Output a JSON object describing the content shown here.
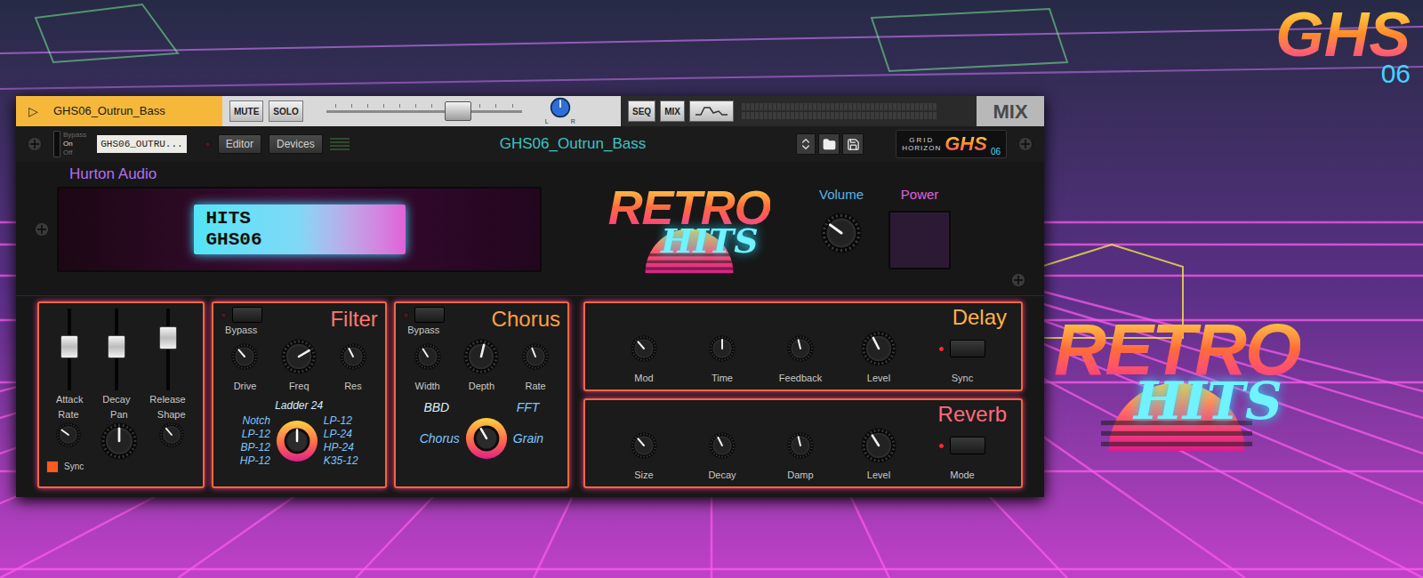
{
  "background": {
    "ghs_logo": {
      "text": "GHS",
      "number": "06"
    },
    "retro_logo": {
      "retro": "RETRO",
      "hits": "HITS"
    }
  },
  "track_strip": {
    "play": "▷",
    "name": "GHS06_Outrun_Bass",
    "buttons": [
      {
        "label": "MUTE",
        "on": false
      },
      {
        "label": "SOLO",
        "on": false
      }
    ],
    "fader": {
      "level": 0.7
    },
    "pan": {
      "level": 0.5,
      "left": "L",
      "right": "R"
    },
    "views": [
      {
        "label": "SEQ",
        "selected": false
      },
      {
        "label": "MIX",
        "selected": false
      }
    ],
    "meter": {
      "level": 0
    },
    "mix_tab": "MIX"
  },
  "device_header": {
    "switch": [
      {
        "label": "Bypass",
        "selected": false
      },
      {
        "label": "On",
        "selected": true
      },
      {
        "label": "Off",
        "selected": false
      }
    ],
    "tape_label": "GHS06_OUTRU...",
    "buttons": [
      "Editor",
      "Devices"
    ],
    "patch_name": "GHS06_Outrun_Bass",
    "brand": {
      "line1": "GRID",
      "line2": "HORIZON",
      "ghs": "GHS",
      "number": "06"
    }
  },
  "maker": "Hurton Audio",
  "display": {
    "line1": "HITS",
    "line2": "GHS06"
  },
  "logo": {
    "retro": "RETRO",
    "hits": "HITS"
  },
  "volume": {
    "label": "Volume",
    "level": 0.3
  },
  "power": {
    "label": "Power",
    "on": false
  },
  "envelope": {
    "sliders": [
      {
        "label": "Attack",
        "level": 0.55
      },
      {
        "label": "Decay",
        "level": 0.55
      },
      {
        "label": "Release",
        "level": 0.7
      }
    ],
    "knobs": [
      {
        "label": "Rate",
        "level": 0.3,
        "kind": "small"
      },
      {
        "label": "Pan",
        "level": 0.5,
        "kind": "large"
      },
      {
        "label": "Shape",
        "level": 0.35,
        "kind": "small"
      }
    ],
    "sync": {
      "label": "Sync",
      "on": true
    }
  },
  "filter": {
    "title": "Filter",
    "bypass": {
      "label": "Bypass",
      "on": false
    },
    "knobs": [
      {
        "label": "Drive",
        "level": 0.35,
        "kind": "small"
      },
      {
        "label": "Freq",
        "level": 0.72,
        "kind": "large"
      },
      {
        "label": "Res",
        "level": 0.4,
        "kind": "small"
      }
    ],
    "selector": {
      "top": [
        {
          "label": "Ladder 24",
          "selected": true
        }
      ],
      "left": [
        {
          "label": "Notch",
          "selected": false
        },
        {
          "label": "LP-12",
          "selected": false
        },
        {
          "label": "BP-12",
          "selected": false
        },
        {
          "label": "HP-12",
          "selected": false
        }
      ],
      "right": [
        {
          "label": "LP-12",
          "selected": false
        },
        {
          "label": "LP-24",
          "selected": false
        },
        {
          "label": "HP-24",
          "selected": false
        },
        {
          "label": "K35-12",
          "selected": false
        }
      ]
    }
  },
  "chorus": {
    "title": "Chorus",
    "bypass": {
      "label": "Bypass",
      "on": false
    },
    "knobs": [
      {
        "label": "Width",
        "level": 0.38,
        "kind": "small"
      },
      {
        "label": "Depth",
        "level": 0.55,
        "kind": "large"
      },
      {
        "label": "Rate",
        "level": 0.42,
        "kind": "small"
      }
    ],
    "selector": {
      "top": [
        {
          "label": "BBD",
          "selected": true
        },
        {
          "label": "FFT",
          "selected": false
        }
      ],
      "left": [
        {
          "label": "Chorus",
          "selected": false
        }
      ],
      "right": [
        {
          "label": "Grain",
          "selected": false
        }
      ]
    }
  },
  "delay": {
    "title": "Delay",
    "knobs": [
      {
        "label": "Mod",
        "level": 0.35,
        "kind": "small"
      },
      {
        "label": "Time",
        "level": 0.5,
        "kind": "small"
      },
      {
        "label": "Feedback",
        "level": 0.45,
        "kind": "small"
      },
      {
        "label": "Level",
        "level": 0.4,
        "kind": "large"
      }
    ],
    "button": {
      "label": "Sync",
      "on": true
    }
  },
  "reverb": {
    "title": "Reverb",
    "knobs": [
      {
        "label": "Size",
        "level": 0.35,
        "kind": "small"
      },
      {
        "label": "Decay",
        "level": 0.4,
        "kind": "small"
      },
      {
        "label": "Damp",
        "level": 0.45,
        "kind": "small"
      },
      {
        "label": "Level",
        "level": 0.38,
        "kind": "large"
      }
    ],
    "button": {
      "label": "Mode",
      "on": true
    }
  }
}
